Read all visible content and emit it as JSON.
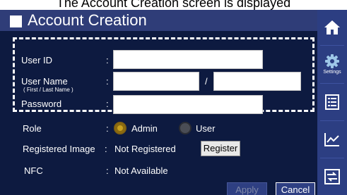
{
  "caption": "The Account Creation screen is displayed",
  "window": {
    "title": "Account Creation"
  },
  "form": {
    "user_id": {
      "label": "User ID",
      "value": ""
    },
    "user_name": {
      "label": "User Name",
      "sublabel": "( First / Last Name )",
      "first": "",
      "last": "",
      "separator": "/"
    },
    "password": {
      "label": "Password",
      "value": ""
    },
    "colon": ":",
    "role": {
      "label": "Role",
      "colon": ":",
      "options": [
        "Admin",
        "User"
      ],
      "selected": "Admin"
    },
    "registered_image": {
      "label": "Registered Image",
      "colon": ":",
      "value": "Not Registered",
      "button": "Register"
    },
    "nfc": {
      "label": "NFC",
      "colon": ":",
      "value": "Not Available"
    }
  },
  "footer": {
    "apply": "Apply",
    "cancel": "Cancel",
    "apply_enabled": false
  },
  "sidebar": {
    "items": [
      {
        "icon": "home-icon"
      },
      {
        "icon": "settings-gear-icon",
        "label": "Settings"
      },
      {
        "icon": "list-icon"
      },
      {
        "icon": "chart-icon"
      },
      {
        "icon": "transfer-icon"
      }
    ]
  },
  "colors": {
    "background": "#0d1a40",
    "titlebar": "#2f3d78",
    "sidebar": "#2c3e82",
    "accent_selected": "#c8a020"
  }
}
